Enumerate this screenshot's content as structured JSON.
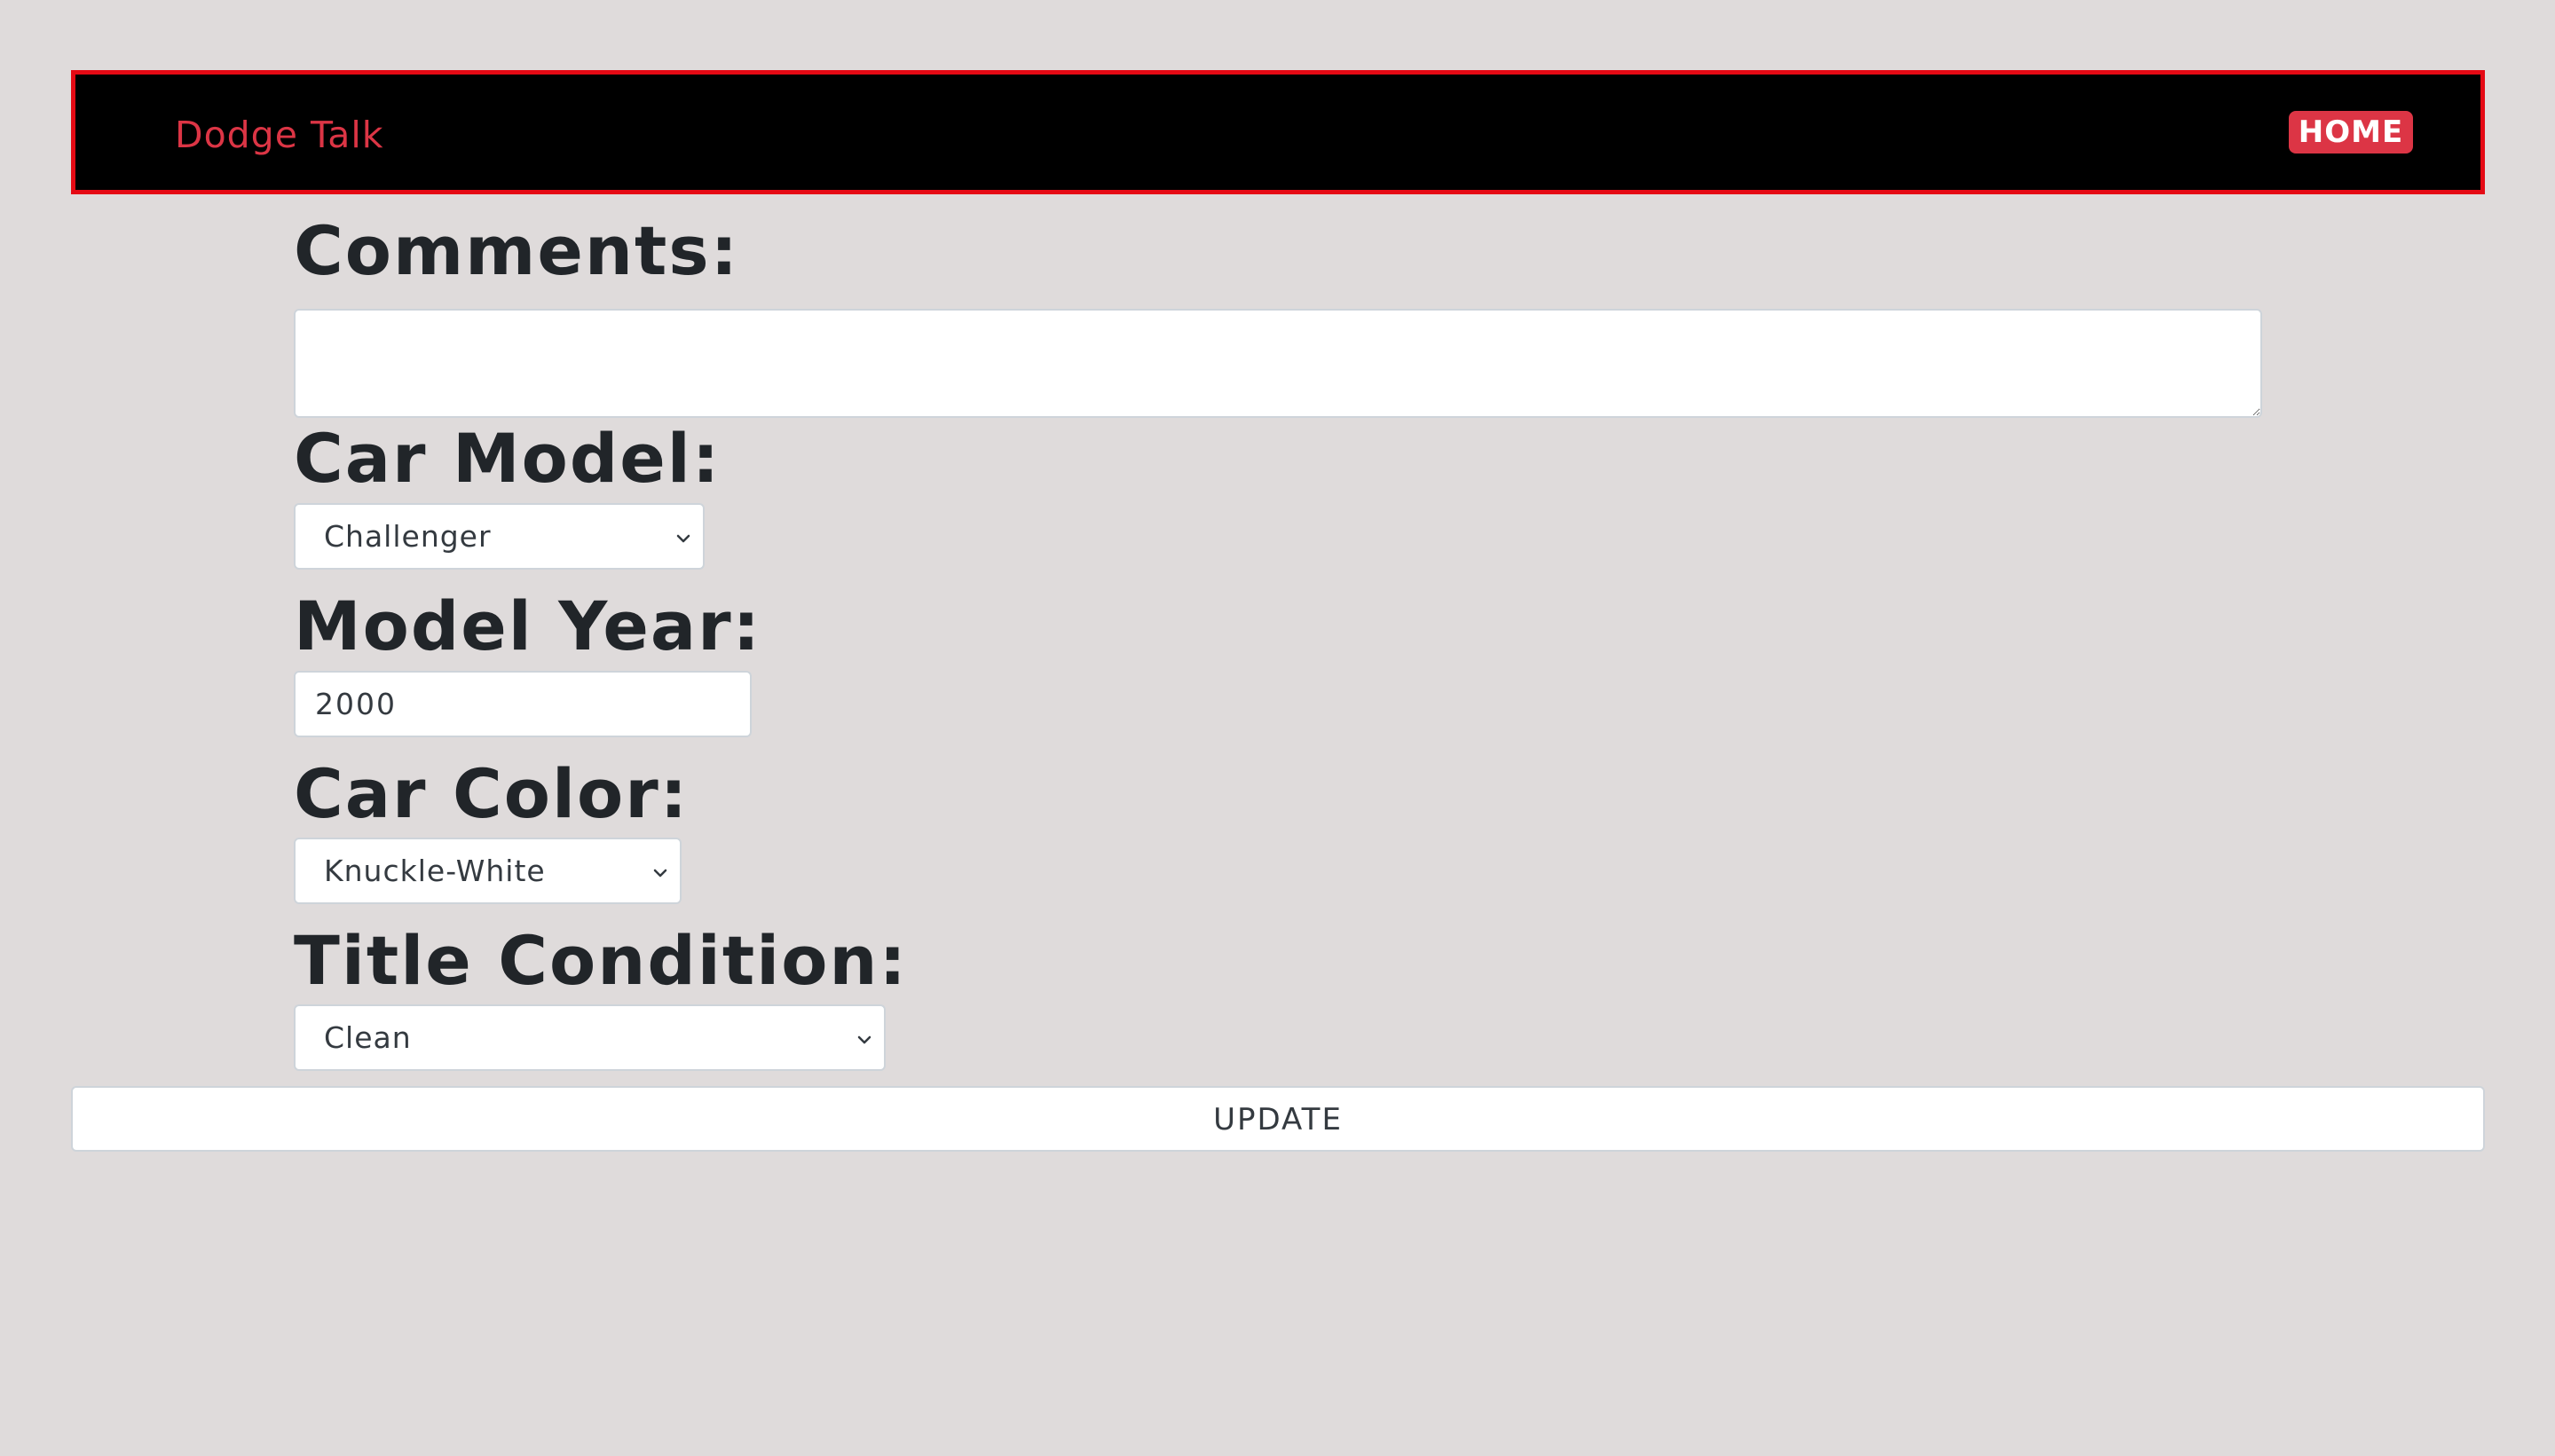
{
  "navbar": {
    "brand": "Dodge Talk",
    "home_label": "HOME"
  },
  "form": {
    "comments_label": "Comments:",
    "comments_value": "",
    "car_model_label": "Car Model:",
    "car_model_value": "Challenger",
    "model_year_label": "Model Year:",
    "model_year_value": "2000",
    "car_color_label": "Car Color:",
    "car_color_value": "Knuckle-White",
    "title_condition_label": "Title Condition:",
    "title_condition_value": "Clean",
    "update_label": "UPDATE"
  },
  "colors": {
    "page_background": "#dfdbdb",
    "navbar_background": "#000000",
    "navbar_border": "#e50914",
    "brand": "#dc3545",
    "home_button": "#dc3545"
  },
  "icons": {
    "select_arrow": "chevron-down-icon"
  }
}
